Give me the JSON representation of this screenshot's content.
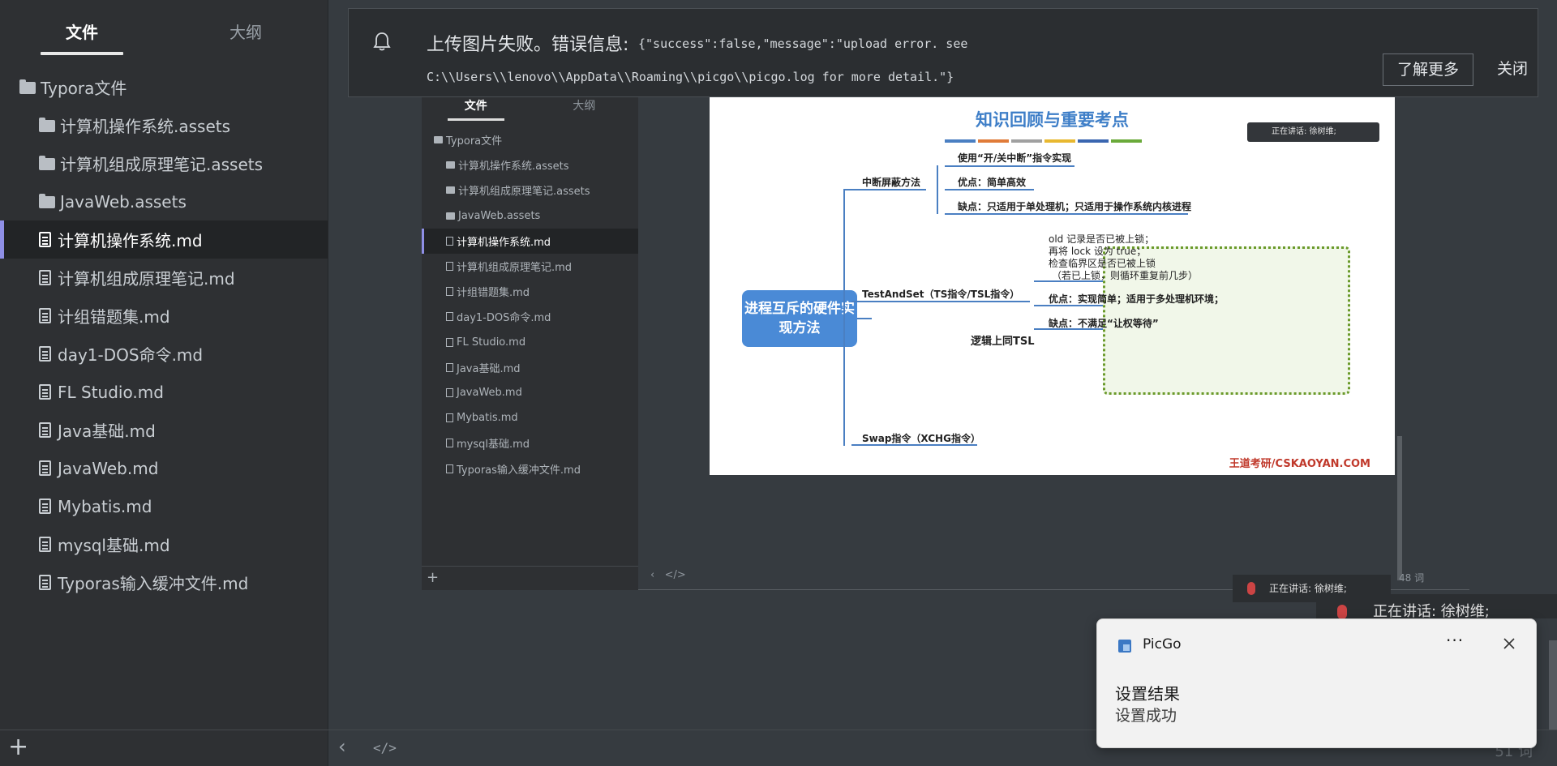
{
  "sidebar": {
    "tabs": [
      {
        "label": "文件",
        "active": true
      },
      {
        "label": "大纲",
        "active": false
      }
    ],
    "root": "Typora文件",
    "items": [
      {
        "label": "计算机操作系统.assets",
        "type": "folder"
      },
      {
        "label": "计算机组成原理笔记.assets",
        "type": "folder"
      },
      {
        "label": "JavaWeb.assets",
        "type": "folder"
      },
      {
        "label": "计算机操作系统.md",
        "type": "file",
        "active": true
      },
      {
        "label": "计算机组成原理笔记.md",
        "type": "file"
      },
      {
        "label": "计组错题集.md",
        "type": "file"
      },
      {
        "label": "day1-DOS命令.md",
        "type": "file"
      },
      {
        "label": "FL Studio.md",
        "type": "file"
      },
      {
        "label": "Java基础.md",
        "type": "file"
      },
      {
        "label": "JavaWeb.md",
        "type": "file"
      },
      {
        "label": "Mybatis.md",
        "type": "file"
      },
      {
        "label": "mysql基础.md",
        "type": "file"
      },
      {
        "label": "Typoras输入缓冲文件.md",
        "type": "file"
      }
    ],
    "add_label": "+"
  },
  "notice": {
    "heading": "上传图片失败。错误信息:",
    "code_line1": "{\"success\":false,\"message\":\"upload error. see",
    "code_line2": "C:\\\\Users\\\\lenovo\\\\AppData\\\\Roaming\\\\picgo\\\\picgo.log for more detail.\"}",
    "learn_more": "了解更多",
    "close": "关闭"
  },
  "embedded": {
    "tabs": [
      "文件",
      "大纲"
    ],
    "root": "Typora文件",
    "items": [
      {
        "label": "计算机操作系统.assets",
        "type": "folder"
      },
      {
        "label": "计算机组成原理笔记.assets",
        "type": "folder"
      },
      {
        "label": "JavaWeb.assets",
        "type": "folder"
      },
      {
        "label": "计算机操作系统.md",
        "type": "file",
        "active": true
      },
      {
        "label": "计算机组成原理笔记.md",
        "type": "file"
      },
      {
        "label": "计组错题集.md",
        "type": "file"
      },
      {
        "label": "day1-DOS命令.md",
        "type": "file"
      },
      {
        "label": "FL Studio.md",
        "type": "file"
      },
      {
        "label": "Java基础.md",
        "type": "file"
      },
      {
        "label": "JavaWeb.md",
        "type": "file"
      },
      {
        "label": "Mybatis.md",
        "type": "file"
      },
      {
        "label": "mysql基础.md",
        "type": "file"
      },
      {
        "label": "Typoras输入缓冲文件.md",
        "type": "file"
      }
    ],
    "word_count": "48 词",
    "slide": {
      "title": "知识回顾与重要考点",
      "bar_colors": [
        "#4a7fc2",
        "#e07b39",
        "#a0a0a0",
        "#e8b830",
        "#3a66b0",
        "#6aaa3a"
      ],
      "speaking": "正在讲话: 徐树维;",
      "root": "进程互斥的硬件实现方法",
      "branches": {
        "b1": "中断屏蔽方法",
        "b1_1": "使用“开/关中断”指令实现",
        "b1_2": "优点：简单高效",
        "b1_3": "缺点：只适用于单处理机；只适用于操作系统内核进程",
        "b2": "TestAndSet（TS指令/TSL指令）",
        "b2_box1": "old 记录是否已被上锁；",
        "b2_box2": "再将 lock 设为 true；",
        "b2_box3": "检查临界区是否已被上锁",
        "b2_box4": "（若已上锁，则循环重复前几步）",
        "b2_2": "优点：实现简单；适用于多处理机环境；",
        "b2_3": "缺点：不满足“让权等待”",
        "b3": "Swap指令（XCHG指令）",
        "logic": "逻辑上同TSL"
      },
      "source": "王道考研/CSKAOYAN.COM"
    },
    "speaker_strip": "正在讲话: 徐树维;"
  },
  "partial_speaker": "正在讲话: 徐树维;",
  "status": {
    "word_count": "51 词"
  },
  "toast": {
    "app": "PicGo",
    "more": "···",
    "title": "设置结果",
    "body": "设置成功"
  }
}
